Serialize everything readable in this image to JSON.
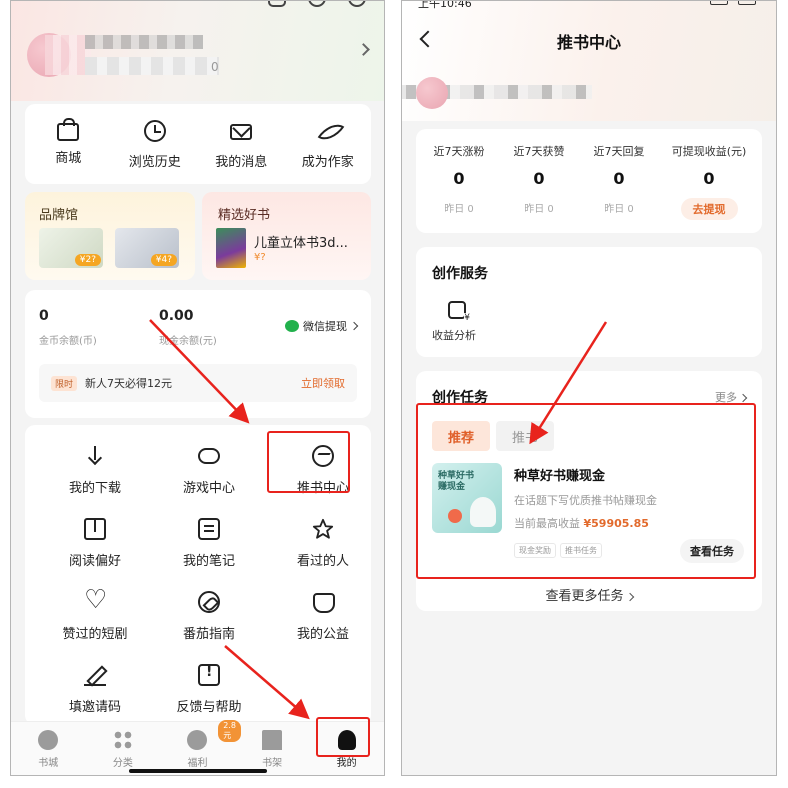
{
  "left": {
    "header": {
      "id_tail": "0"
    },
    "quick_actions": [
      {
        "label": "商城",
        "icon": "bag-icon"
      },
      {
        "label": "浏览历史",
        "icon": "clock-icon"
      },
      {
        "label": "我的消息",
        "icon": "mail-icon"
      },
      {
        "label": "成为作家",
        "icon": "feather-icon"
      }
    ],
    "brand_hall": {
      "title": "品牌馆",
      "price1": "¥2?",
      "price2": "¥4?"
    },
    "featured_book": {
      "title": "精选好书",
      "book_title": "儿童立体书3d...",
      "price": "¥?"
    },
    "wallet": {
      "coin_value": "0",
      "coin_label": "金币余额(币)",
      "cash_value": "0.00",
      "cash_label": "现金余额(元)",
      "wechat_withdraw": "微信提现",
      "new_user_tag": "限时",
      "new_user_text": "新人7天必得12元",
      "claim": "立即领取"
    },
    "menu": [
      {
        "label": "我的下载",
        "icon": "download-icon"
      },
      {
        "label": "游戏中心",
        "icon": "gamepad-icon"
      },
      {
        "label": "推书中心",
        "icon": "recommend-icon"
      },
      {
        "label": "阅读偏好",
        "icon": "book-icon"
      },
      {
        "label": "我的笔记",
        "icon": "note-icon"
      },
      {
        "label": "看过的人",
        "icon": "star-icon"
      },
      {
        "label": "赞过的短剧",
        "icon": "heart-icon"
      },
      {
        "label": "番茄指南",
        "icon": "compass-icon"
      },
      {
        "label": "我的公益",
        "icon": "charity-icon"
      },
      {
        "label": "填邀请码",
        "icon": "pen-icon"
      },
      {
        "label": "反馈与帮助",
        "icon": "feedback-icon"
      }
    ],
    "tabbar": [
      {
        "label": "书城",
        "icon": "bookstore-icon"
      },
      {
        "label": "分类",
        "icon": "category-icon"
      },
      {
        "label": "福利",
        "icon": "welfare-icon",
        "badge": "2.8元"
      },
      {
        "label": "书架",
        "icon": "bookshelf-icon"
      },
      {
        "label": "我的",
        "icon": "person-icon",
        "active": true
      }
    ]
  },
  "right": {
    "status_time": "上午10:46",
    "title": "推书中心",
    "stats": [
      {
        "label": "近7天涨粉",
        "value": "0",
        "sub": "昨日 0"
      },
      {
        "label": "近7天获赞",
        "value": "0",
        "sub": "昨日 0"
      },
      {
        "label": "近7天回复",
        "value": "0",
        "sub": "昨日 0"
      },
      {
        "label": "可提现收益(元)",
        "value": "0",
        "button": "去提现"
      }
    ],
    "service": {
      "title": "创作服务",
      "item_label": "收益分析"
    },
    "tasks": {
      "title": "创作任务",
      "more": "更多",
      "tab_active": "推荐",
      "tab_idle": "推书",
      "thumb_line1": "种草好书",
      "thumb_line2": "赚现金",
      "name": "种草好书赚现金",
      "desc": "在话题下写优质推书帖赚现金",
      "earn_prefix": "当前最高收益",
      "earn_amount": "¥59905.85",
      "tag1": "现金奖励",
      "tag2": "推书任务",
      "view_button": "查看任务",
      "view_more": "查看更多任务"
    }
  },
  "colors": {
    "highlight": "#e8231d",
    "accent": "#e26a2c",
    "wechat": "#22b14c"
  }
}
